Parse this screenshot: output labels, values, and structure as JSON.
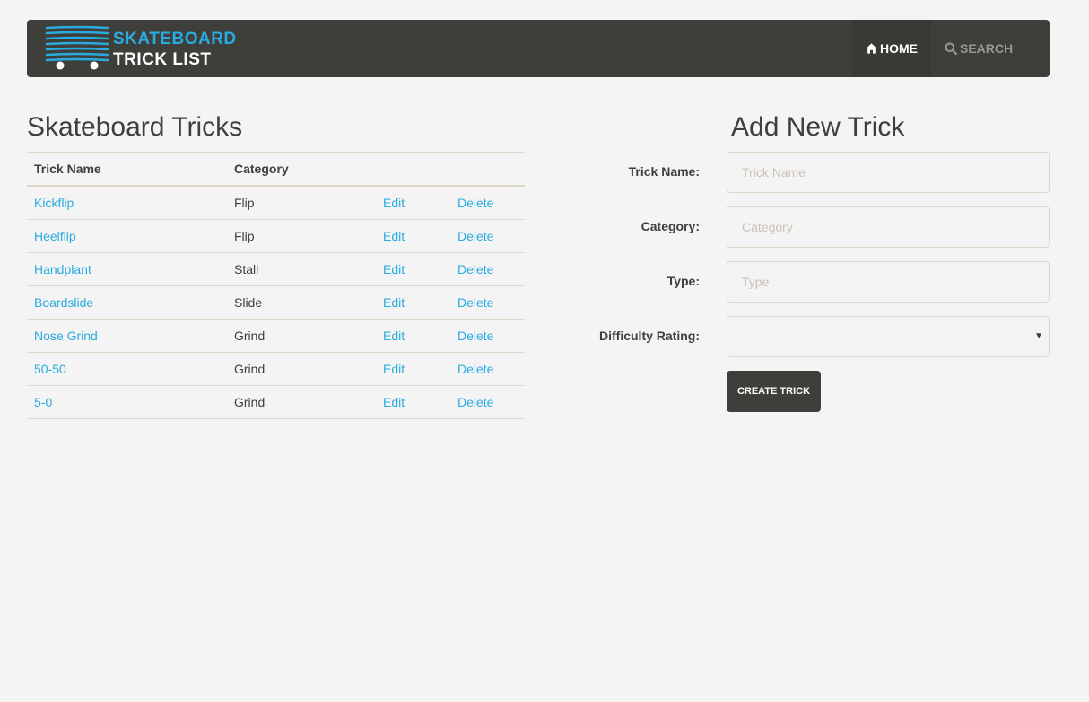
{
  "brand": {
    "line1": "SKATEBOARD",
    "line2": "TRICK LIST",
    "logo_icon": "skateboard-stack-icon"
  },
  "nav": {
    "home_label": "HOME",
    "search_label": "SEARCH",
    "home_icon": "home-icon",
    "search_icon": "search-icon"
  },
  "list": {
    "title": "Skateboard Tricks",
    "columns": [
      "Trick Name",
      "Category"
    ],
    "edit_label": "Edit",
    "delete_label": "Delete",
    "rows": [
      {
        "name": "Kickflip",
        "category": "Flip"
      },
      {
        "name": "Heelflip",
        "category": "Flip"
      },
      {
        "name": "Handplant",
        "category": "Stall"
      },
      {
        "name": "Boardslide",
        "category": "Slide"
      },
      {
        "name": "Nose Grind",
        "category": "Grind"
      },
      {
        "name": "50-50",
        "category": "Grind"
      },
      {
        "name": "5-0",
        "category": "Grind"
      }
    ]
  },
  "form": {
    "title": "Add New Trick",
    "name_label": "Trick Name:",
    "name_placeholder": "Trick Name",
    "name_value": "",
    "category_label": "Category:",
    "category_placeholder": "Category",
    "category_value": "",
    "type_label": "Type:",
    "type_placeholder": "Type",
    "type_value": "",
    "difficulty_label": "Difficulty Rating:",
    "difficulty_value": "",
    "submit_label": "CREATE TRICK"
  },
  "colors": {
    "navbar": "#3e3f3a",
    "accent": "#29abe0",
    "background": "#f4f4f4"
  }
}
